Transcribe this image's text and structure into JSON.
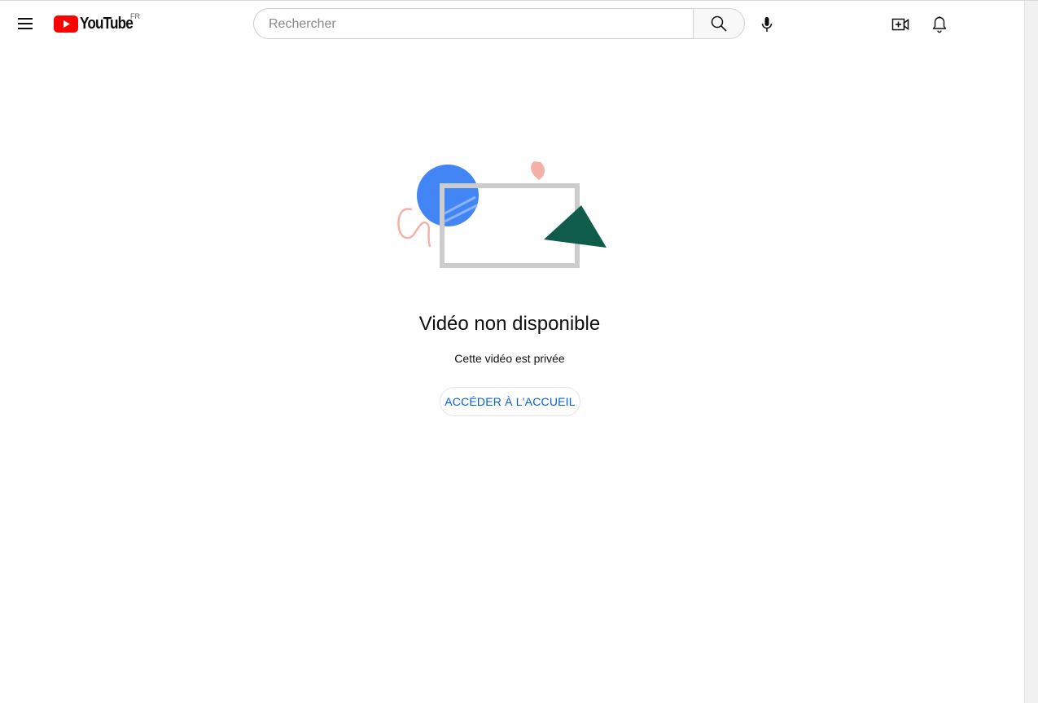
{
  "masthead": {
    "logo_text": "YouTube",
    "country_code": "FR",
    "search": {
      "placeholder": "Rechercher",
      "value": ""
    },
    "icons": {
      "menu": "hamburger-menu-icon",
      "logo": "youtube-logo-icon",
      "search": "search-icon",
      "voice": "microphone-icon",
      "create": "video-camera-plus-icon",
      "notifications": "bell-icon"
    }
  },
  "error": {
    "title": "Vidéo non disponible",
    "reason": "Cette vidéo est privée",
    "home_button": "ACCÉDER À L'ACCUEIL"
  },
  "colors": {
    "brand_red": "#ff0000",
    "link_blue": "#065fd4",
    "illustration_blue": "#4285f4",
    "illustration_green": "#0f5c4a",
    "illustration_pink": "#f5b1a8",
    "frame_gray": "#cccccc"
  }
}
